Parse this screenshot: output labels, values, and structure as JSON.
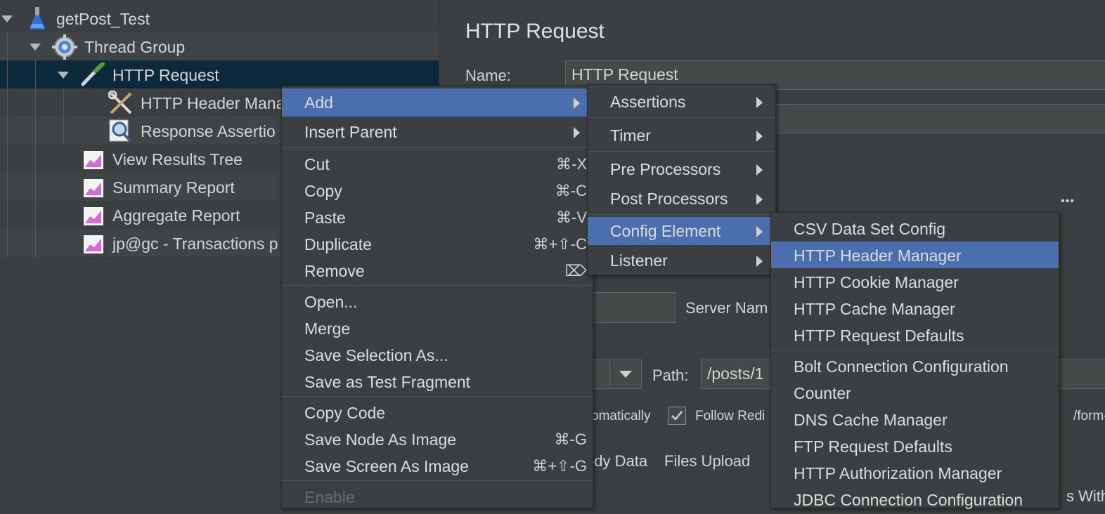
{
  "tree": {
    "items": [
      {
        "label": "getPost_Test"
      },
      {
        "label": "Thread Group"
      },
      {
        "label": "HTTP Request"
      },
      {
        "label": "HTTP Header Mana"
      },
      {
        "label": "Response Assertio"
      },
      {
        "label": "View Results Tree"
      },
      {
        "label": "Summary Report"
      },
      {
        "label": "Aggregate Report"
      },
      {
        "label": "jp@gc - Transactions p"
      }
    ]
  },
  "panel": {
    "title": "HTTP Request",
    "name_label": "Name:",
    "name_value": "HTTP Request",
    "server_label": "Server Nam",
    "path_label": "Path:",
    "path_value": "/posts/1",
    "auto_text": "omatically",
    "follow_label": "Follow Redi",
    "form_text": "/form-c",
    "body_tab": "ody Data",
    "files_tab": "Files Upload",
    "with_text": "s With",
    "more": "•••"
  },
  "context_menu": {
    "items": [
      {
        "label": "Add",
        "shortcut": ""
      },
      {
        "label": "Insert Parent",
        "shortcut": ""
      },
      {
        "label": "Cut",
        "shortcut": "⌘-X"
      },
      {
        "label": "Copy",
        "shortcut": "⌘-C"
      },
      {
        "label": "Paste",
        "shortcut": "⌘-V"
      },
      {
        "label": "Duplicate",
        "shortcut": "⌘+⇧-C"
      },
      {
        "label": "Remove",
        "shortcut": "⌦"
      },
      {
        "label": "Open...",
        "shortcut": ""
      },
      {
        "label": "Merge",
        "shortcut": ""
      },
      {
        "label": "Save Selection As...",
        "shortcut": ""
      },
      {
        "label": "Save as Test Fragment",
        "shortcut": ""
      },
      {
        "label": "Copy Code",
        "shortcut": ""
      },
      {
        "label": "Save Node As Image",
        "shortcut": "⌘-G"
      },
      {
        "label": "Save Screen As Image",
        "shortcut": "⌘+⇧-G"
      },
      {
        "label": "Enable",
        "shortcut": ""
      }
    ]
  },
  "add_menu": {
    "items": [
      {
        "label": "Assertions"
      },
      {
        "label": "Timer"
      },
      {
        "label": "Pre Processors"
      },
      {
        "label": "Post Processors"
      },
      {
        "label": "Config Element"
      },
      {
        "label": "Listener"
      }
    ]
  },
  "config_menu": {
    "items": [
      {
        "label": "CSV Data Set Config"
      },
      {
        "label": "HTTP Header Manager"
      },
      {
        "label": "HTTP Cookie Manager"
      },
      {
        "label": "HTTP Cache Manager"
      },
      {
        "label": "HTTP Request Defaults"
      },
      {
        "label": "Bolt Connection Configuration"
      },
      {
        "label": "Counter"
      },
      {
        "label": "DNS Cache Manager"
      },
      {
        "label": "FTP Request Defaults"
      },
      {
        "label": "HTTP Authorization Manager"
      },
      {
        "label": "JDBC Connection Configuration"
      }
    ]
  },
  "colors": {
    "background": "#3c3f41",
    "menu_highlight": "#4b6eaf",
    "tree_selection": "#0d293e"
  }
}
